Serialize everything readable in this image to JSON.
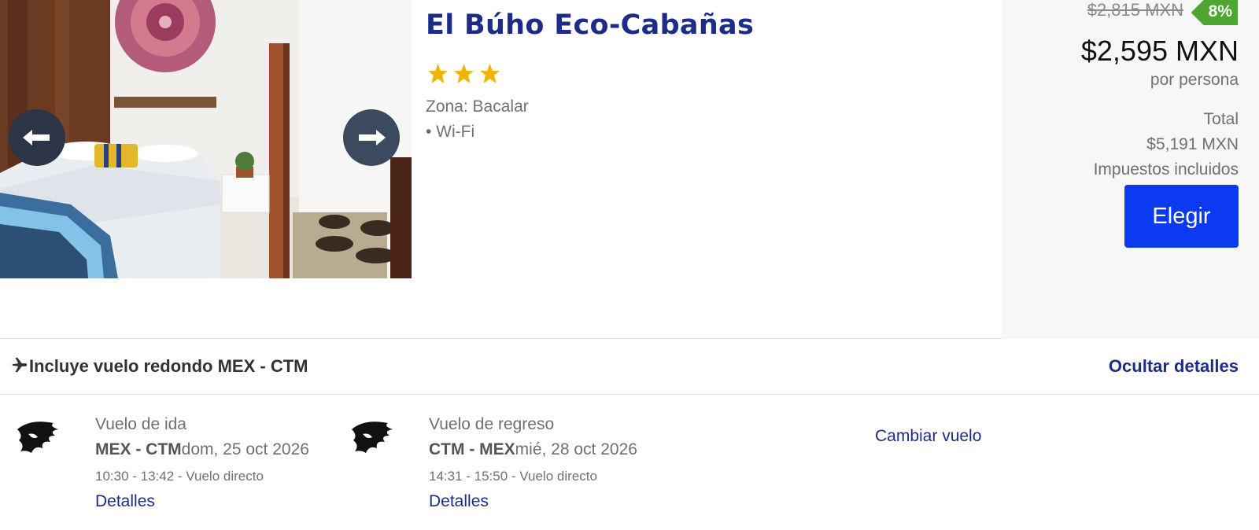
{
  "hotel": {
    "name": "El Búho Eco-Cabañas",
    "stars": 3,
    "zone": "Zona: Bacalar",
    "amenities": [
      "• Wi-Fi"
    ],
    "gallery": {
      "prev_icon": "arrow-left-icon",
      "next_icon": "arrow-right-icon"
    }
  },
  "pricing": {
    "old_price": "$2,815 MXN",
    "discount": "8%",
    "price": "$2,595 MXN",
    "per_person": "por persona",
    "total_label": "Total",
    "total_value": "$5,191 MXN",
    "taxes_note": "Impuestos incluidos",
    "choose_label": "Elegir"
  },
  "flight": {
    "header_icon": "plane-icon",
    "header": "Incluye vuelo redondo MEX - CTM",
    "hide_details": "Ocultar detalles",
    "change_flight": "Cambiar vuelo",
    "outbound": {
      "label": "Vuelo de ida",
      "route": "MEX - CTM",
      "date": "dom, 25 oct 2026",
      "times": "10:30 - 13:42 - Vuelo directo",
      "details": "Detalles"
    },
    "return": {
      "label": "Vuelo de regreso",
      "route": "CTM - MEX",
      "date": "mié, 28 oct 2026",
      "times": "14:31 - 15:50 - Vuelo directo",
      "details": "Detalles"
    }
  },
  "colors": {
    "brand_blue": "#1c2c88",
    "button_blue": "#0c3af0",
    "discount_green": "#4ea530",
    "star_gold": "#f0b400"
  }
}
